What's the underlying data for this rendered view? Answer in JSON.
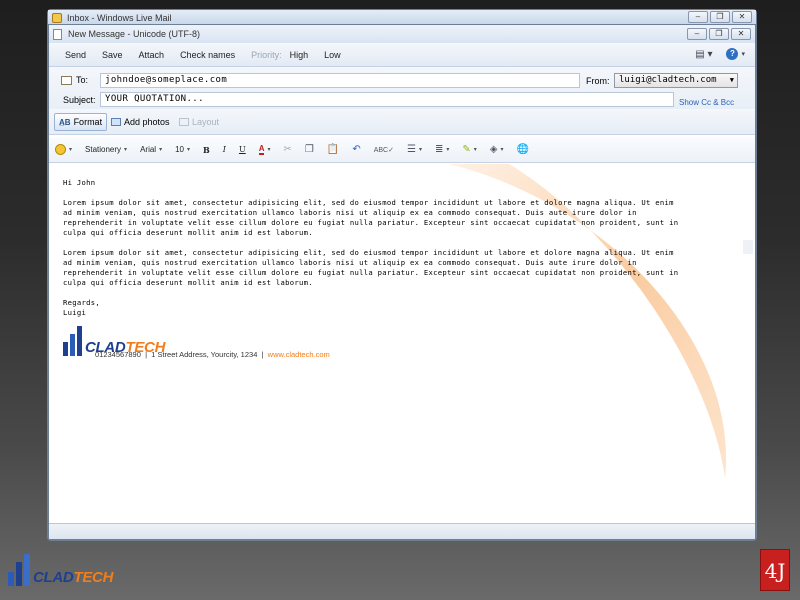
{
  "back_window": {
    "title": "Inbox - Windows Live Mail",
    "caption_buttons": [
      "–",
      "❐",
      "✕"
    ]
  },
  "front_window": {
    "title": "New Message - Unicode (UTF-8)",
    "caption_buttons": [
      "–",
      "❐",
      "✕"
    ]
  },
  "menu": {
    "send": "Send",
    "save": "Save",
    "attach": "Attach",
    "check_names": "Check names",
    "priority": "Priority:",
    "high": "High",
    "low": "Low"
  },
  "header": {
    "to_label": "To:",
    "to_value": "johndoe@someplace.com",
    "from_label": "From:",
    "from_value": "luigi@cladtech.com",
    "subject_label": "Subject:",
    "subject_value": "YOUR QUOTATION...",
    "show_cc": "Show Cc & Bcc"
  },
  "format_row": {
    "format": "Format",
    "add_photos": "Add photos",
    "layout": "Layout"
  },
  "toolbar": {
    "stationery": "Stationery",
    "font": "Arial",
    "size": "10",
    "bold": "B",
    "italic": "I",
    "underline": "U",
    "font_color": "A"
  },
  "message": {
    "greeting": "Hi John",
    "paragraph1": "Lorem ipsum dolor sit amet, consectetur adipisicing elit, sed do eiusmod tempor incididunt ut labore et dolore magna aliqua. Ut enim ad minim veniam, quis nostrud exercitation ullamco laboris nisi ut aliquip ex ea commodo consequat. Duis aute irure dolor in reprehenderit in voluptate velit esse cillum dolore eu fugiat nulla pariatur. Excepteur sint occaecat cupidatat non proident, sunt in culpa qui officia deserunt mollit anim id est laborum.",
    "paragraph2": "Lorem ipsum dolor sit amet, consectetur adipisicing elit, sed do eiusmod tempor incididunt ut labore et dolore magna aliqua. Ut enim ad minim veniam, quis nostrud exercitation ullamco laboris nisi ut aliquip ex ea commodo consequat. Duis aute irure dolor in reprehenderit in voluptate velit esse cillum dolore eu fugiat nulla pariatur. Excepteur sint occaecat cupidatat non proident, sunt in culpa qui officia deserunt mollit anim id est laborum.",
    "closing": "Regards,",
    "name": "Luigi"
  },
  "signature": {
    "logo_part1": "CLAD",
    "logo_part2": "TECH",
    "phone": "01234567890",
    "separator": "|",
    "address": "1 Street Address, Yourcity, 1234",
    "website": "www.cladtech.com"
  },
  "footer": {
    "logo_part1": "CLAD",
    "logo_part2": "TECH",
    "mark": "4J"
  },
  "colors": {
    "brand_blue": "#1f3f8f",
    "brand_orange": "#f07e1c",
    "link_blue": "#2a62b8"
  }
}
